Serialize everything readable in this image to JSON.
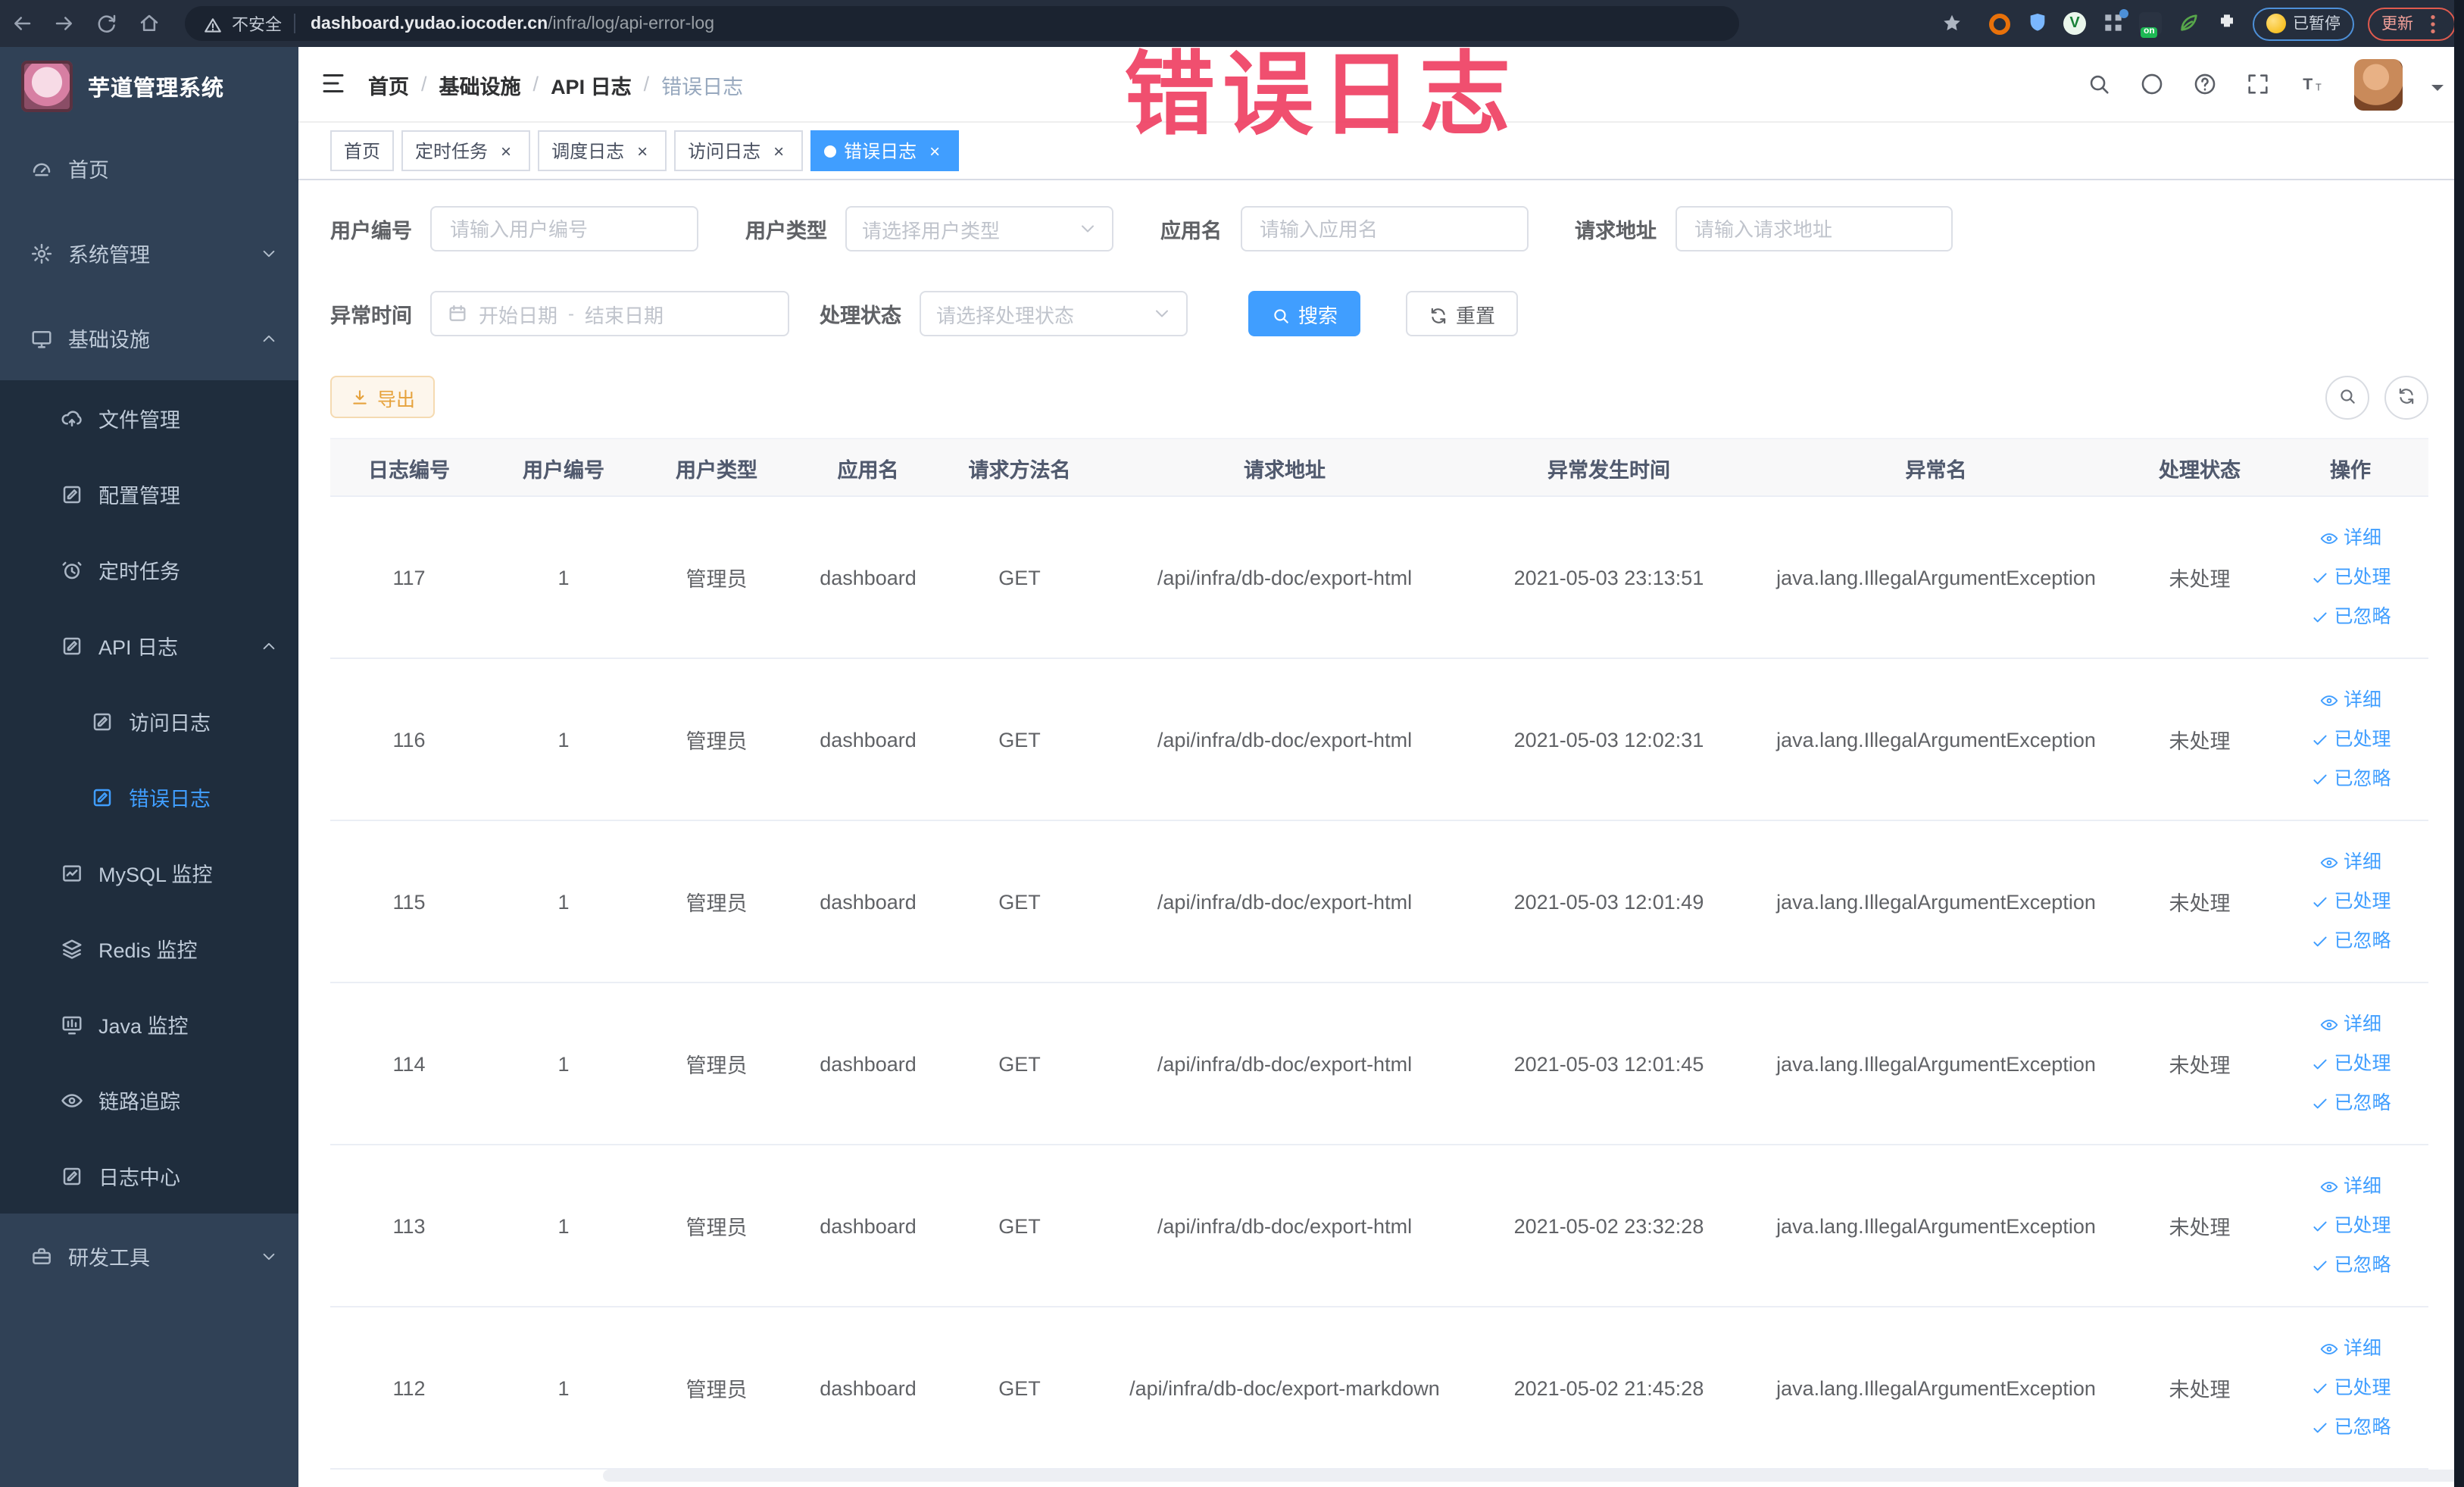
{
  "browser": {
    "security_label": "不安全",
    "url_host": "dashboard.yudao.iocoder.cn",
    "url_path": "/infra/log/api-error-log",
    "paused_label": "已暂停",
    "update_label": "更新"
  },
  "overlay": {
    "annotation": "错误日志"
  },
  "app": {
    "title": "芋道管理系统"
  },
  "breadcrumb": {
    "items": [
      "首页",
      "基础设施",
      "API 日志",
      "错误日志"
    ]
  },
  "tags": [
    {
      "label": "首页",
      "closable": false,
      "active": false
    },
    {
      "label": "定时任务",
      "closable": true,
      "active": false
    },
    {
      "label": "调度日志",
      "closable": true,
      "active": false
    },
    {
      "label": "访问日志",
      "closable": true,
      "active": false
    },
    {
      "label": "错误日志",
      "closable": true,
      "active": true
    }
  ],
  "sidebar": {
    "items": [
      {
        "label": "首页",
        "icon": "dashboard",
        "level": 1,
        "chevron": null,
        "active": false,
        "dark": false
      },
      {
        "label": "系统管理",
        "icon": "gear",
        "level": 1,
        "chevron": "down",
        "active": false,
        "dark": false
      },
      {
        "label": "基础设施",
        "icon": "monitor",
        "level": 1,
        "chevron": "up",
        "active": false,
        "dark": false
      },
      {
        "label": "文件管理",
        "icon": "cloud-upload",
        "level": 2,
        "chevron": null,
        "active": false,
        "dark": true
      },
      {
        "label": "配置管理",
        "icon": "edit-square",
        "level": 2,
        "chevron": null,
        "active": false,
        "dark": true
      },
      {
        "label": "定时任务",
        "icon": "timer",
        "level": 2,
        "chevron": null,
        "active": false,
        "dark": true
      },
      {
        "label": "API 日志",
        "icon": "edit-square",
        "level": 2,
        "chevron": "up",
        "active": false,
        "dark": true
      },
      {
        "label": "访问日志",
        "icon": "edit-square",
        "level": 3,
        "chevron": null,
        "active": false,
        "dark": true
      },
      {
        "label": "错误日志",
        "icon": "edit-square",
        "level": 3,
        "chevron": null,
        "active": true,
        "dark": true
      },
      {
        "label": "MySQL 监控",
        "icon": "chart",
        "level": 2,
        "chevron": null,
        "active": false,
        "dark": true
      },
      {
        "label": "Redis 监控",
        "icon": "layers",
        "level": 2,
        "chevron": null,
        "active": false,
        "dark": true
      },
      {
        "label": "Java 监控",
        "icon": "java-monitor",
        "level": 2,
        "chevron": null,
        "active": false,
        "dark": true
      },
      {
        "label": "链路追踪",
        "icon": "eye",
        "level": 2,
        "chevron": null,
        "active": false,
        "dark": true
      },
      {
        "label": "日志中心",
        "icon": "edit-square",
        "level": 2,
        "chevron": null,
        "active": false,
        "dark": true
      },
      {
        "label": "研发工具",
        "icon": "toolbox",
        "level": 1,
        "chevron": "down",
        "active": false,
        "dark": false
      }
    ]
  },
  "filters": {
    "user_id": {
      "label": "用户编号",
      "placeholder": "请输入用户编号"
    },
    "user_type": {
      "label": "用户类型",
      "placeholder": "请选择用户类型"
    },
    "app_name": {
      "label": "应用名",
      "placeholder": "请输入应用名"
    },
    "request_url": {
      "label": "请求地址",
      "placeholder": "请输入请求地址"
    },
    "exception_time": {
      "label": "异常时间",
      "start_placeholder": "开始日期",
      "separator": "-",
      "end_placeholder": "结束日期"
    },
    "process_status": {
      "label": "处理状态",
      "placeholder": "请选择处理状态"
    },
    "search_label": "搜索",
    "reset_label": "重置"
  },
  "toolbar": {
    "export_label": "导出"
  },
  "table": {
    "columns": [
      "日志编号",
      "用户编号",
      "用户类型",
      "应用名",
      "请求方法名",
      "请求地址",
      "异常发生时间",
      "异常名",
      "处理状态",
      "操作"
    ],
    "rows": [
      [
        "117",
        "1",
        "管理员",
        "dashboard",
        "GET",
        "/api/infra/db-doc/export-html",
        "2021-05-03 23:13:51",
        "java.lang.IllegalArgumentException",
        "未处理"
      ],
      [
        "116",
        "1",
        "管理员",
        "dashboard",
        "GET",
        "/api/infra/db-doc/export-html",
        "2021-05-03 12:02:31",
        "java.lang.IllegalArgumentException",
        "未处理"
      ],
      [
        "115",
        "1",
        "管理员",
        "dashboard",
        "GET",
        "/api/infra/db-doc/export-html",
        "2021-05-03 12:01:49",
        "java.lang.IllegalArgumentException",
        "未处理"
      ],
      [
        "114",
        "1",
        "管理员",
        "dashboard",
        "GET",
        "/api/infra/db-doc/export-html",
        "2021-05-03 12:01:45",
        "java.lang.IllegalArgumentException",
        "未处理"
      ],
      [
        "113",
        "1",
        "管理员",
        "dashboard",
        "GET",
        "/api/infra/db-doc/export-html",
        "2021-05-02 23:32:28",
        "java.lang.IllegalArgumentException",
        "未处理"
      ],
      [
        "112",
        "1",
        "管理员",
        "dashboard",
        "GET",
        "/api/infra/db-doc/export-markdown",
        "2021-05-02 21:45:28",
        "java.lang.IllegalArgumentException",
        "未处理"
      ]
    ],
    "row_actions": [
      {
        "icon": "view",
        "label": "详细"
      },
      {
        "icon": "check",
        "label": "已处理"
      },
      {
        "icon": "check",
        "label": "已忽略"
      }
    ]
  },
  "colors": {
    "accent": "#409eff",
    "warning": "#e6a23c",
    "annotation": "#ef4265",
    "sidebar_bg": "#304156",
    "submenu_bg": "#1f2d3d"
  }
}
